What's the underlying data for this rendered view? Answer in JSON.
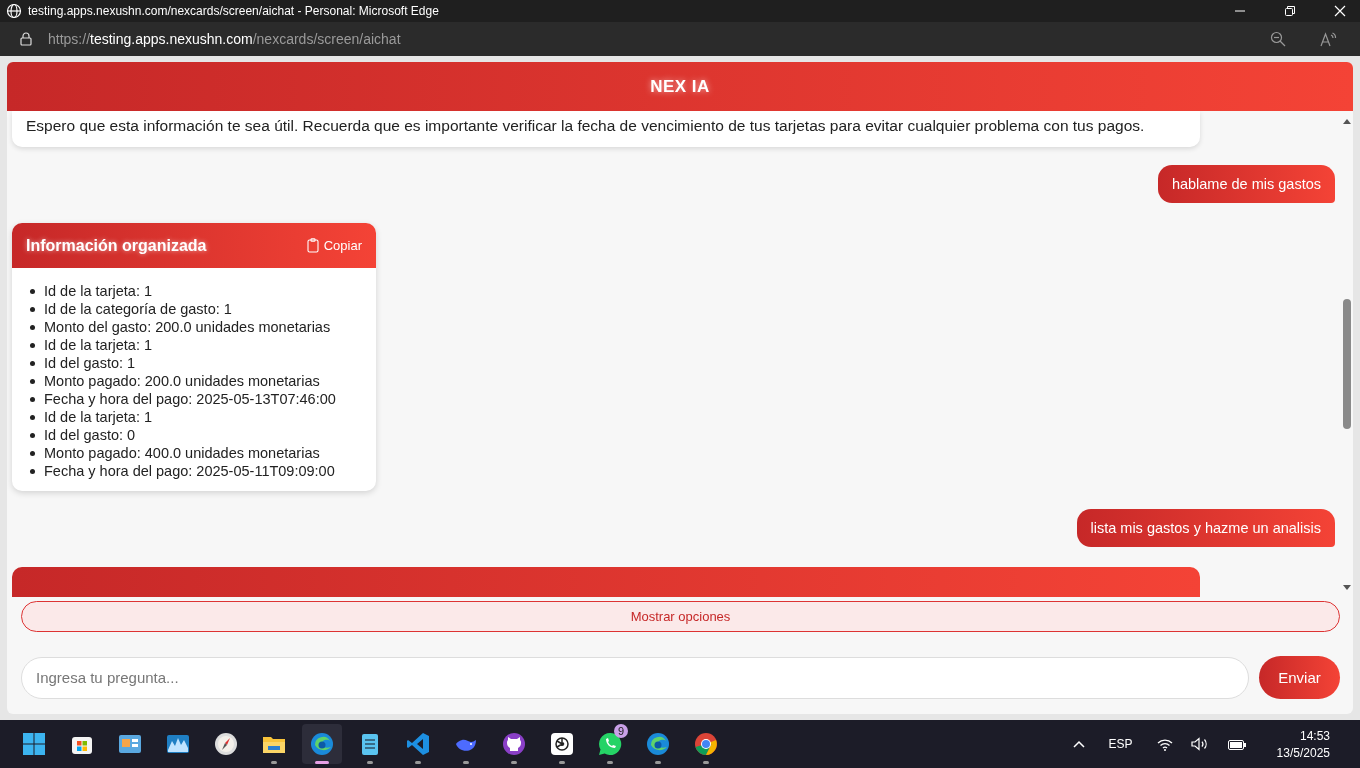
{
  "window": {
    "title": "testing.apps.nexushn.com/nexcards/screen/aichat - Personal: Microsoft Edge"
  },
  "address_bar": {
    "scheme": "https://",
    "host": "testing.apps.nexushn.com",
    "path": "/nexcards/screen/aichat"
  },
  "header": {
    "title": "NEX IA"
  },
  "messages": [
    {
      "kind": "assistant_text",
      "text": "Espero que esta información te sea útil. Recuerda que es importante verificar la fecha de vencimiento de tus tarjetas para evitar cualquier problema con tus pagos."
    },
    {
      "kind": "user_text",
      "text": "hablame de mis gastos"
    },
    {
      "kind": "card",
      "title": "Información organizada",
      "copy_label": "Copiar",
      "items": [
        "Id de la tarjeta: 1",
        "Id de la categoría de gasto: 1",
        "Monto del gasto: 200.0 unidades monetarias",
        "Id de la tarjeta: 1",
        "Id del gasto: 1",
        "Monto pagado: 200.0 unidades monetarias",
        "Fecha y hora del pago: 2025-05-13T07:46:00",
        "Id de la tarjeta: 1",
        "Id del gasto: 0",
        "Monto pagado: 400.0 unidades monetarias",
        "Fecha y hora del pago: 2025-05-11T09:09:00"
      ]
    },
    {
      "kind": "user_text",
      "text": "lista mis gastos y hazme un analisis"
    },
    {
      "kind": "cut_card"
    }
  ],
  "options_button": "Mostrar opciones",
  "composer": {
    "placeholder": "Ingresa tu pregunta...",
    "send_label": "Enviar"
  },
  "taskbar": {
    "apps": [
      {
        "kind": "start",
        "running": false,
        "selected": false
      },
      {
        "kind": "store",
        "running": false,
        "selected": false
      },
      {
        "kind": "monitor",
        "running": false,
        "selected": false
      },
      {
        "kind": "wave",
        "running": false,
        "selected": false
      },
      {
        "kind": "compass",
        "running": false,
        "selected": false
      },
      {
        "kind": "folder",
        "running": true,
        "selected": false
      },
      {
        "kind": "edge",
        "running": true,
        "selected": true
      },
      {
        "kind": "notepad",
        "running": true,
        "selected": false
      },
      {
        "kind": "code",
        "running": true,
        "selected": false
      },
      {
        "kind": "whale",
        "running": true,
        "selected": false
      },
      {
        "kind": "cat",
        "running": true,
        "selected": false
      },
      {
        "kind": "knot",
        "running": true,
        "selected": false
      },
      {
        "kind": "chat",
        "running": true,
        "selected": false,
        "badge": "9"
      },
      {
        "kind": "edge",
        "running": true,
        "selected": false
      },
      {
        "kind": "chrome",
        "running": true,
        "selected": false
      }
    ]
  },
  "tray": {
    "language": "ESP",
    "time": "14:53",
    "date": "13/5/2025"
  }
}
